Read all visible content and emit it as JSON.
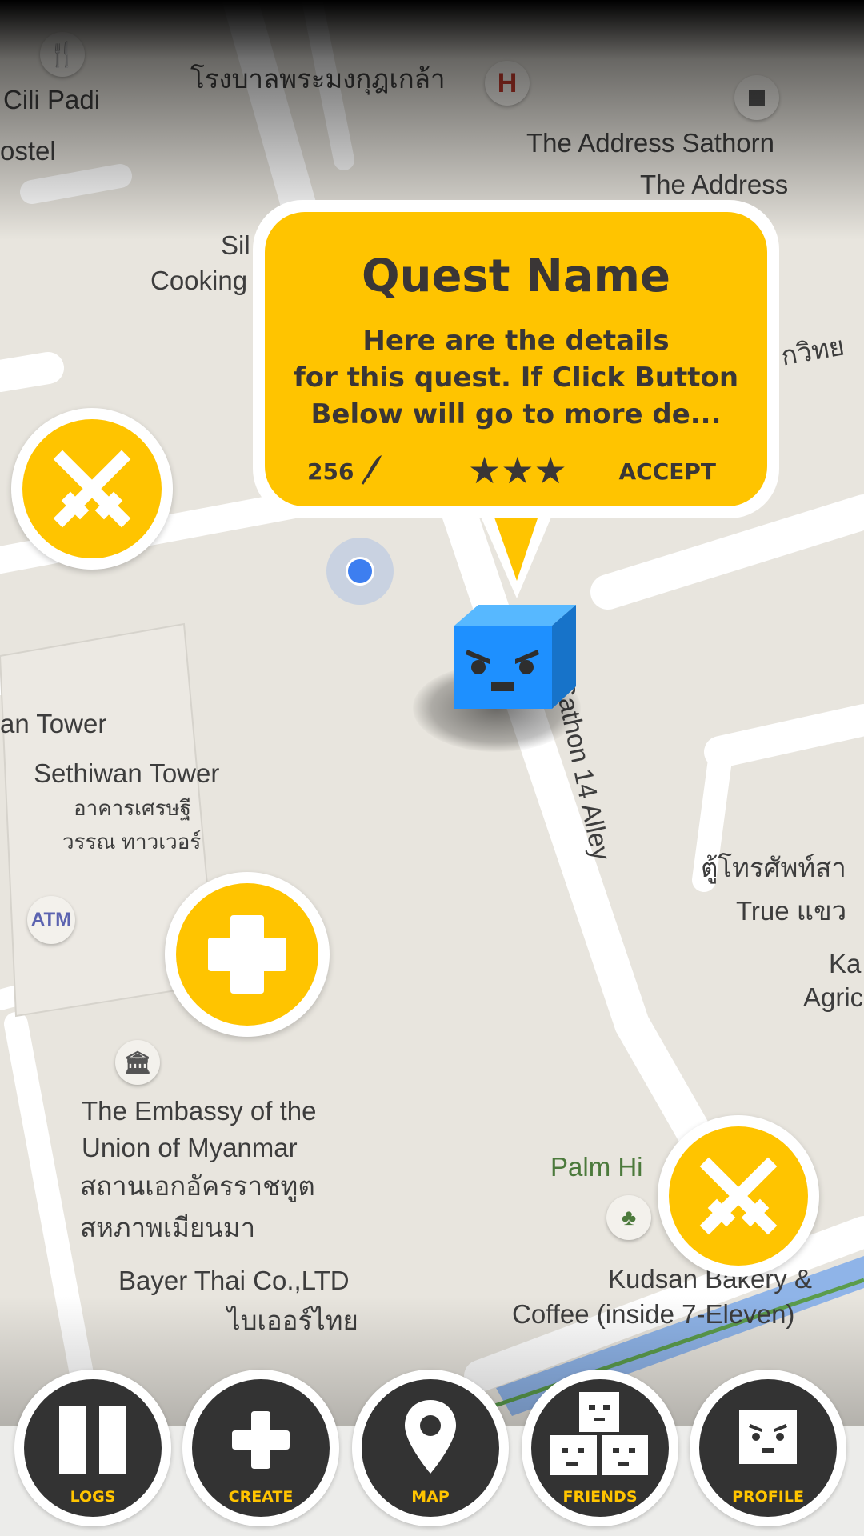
{
  "map": {
    "labels": {
      "cili_padi": "Cili Padi",
      "hostel": "ostel",
      "hospital_thai": "โรงบาลพระมงกุฎเกล้า",
      "address_sathorn": "The Address Sathorn",
      "the_address": "The Address",
      "sil": "Sil",
      "cooking": "Cooking",
      "thai_right": "กวิทย",
      "tower_cut": "an Tower",
      "sethiwan": "Sethiwan Tower",
      "sethiwan_thai1": "อาคารเศรษฐี",
      "sethiwan_thai2": "วรรณ ทาวเวอร์",
      "atm": "ATM",
      "sathon_alley": "Sathon 14 Alley",
      "phone_thai": "ตู้โทรศัพท์สา",
      "true_thai": "True แขว",
      "ka": "Ka",
      "agric": "Agric",
      "embassy1": "The Embassy of the",
      "embassy2": "Union of Myanmar",
      "embassy_thai1": "สถานเอกอัครราชทูต",
      "embassy_thai2": "สหภาพเมียนมา",
      "palm_hi": "Palm Hi",
      "bayer1": "Bayer Thai Co.,LTD",
      "bayer_thai": "ไบเออร์ไทย",
      "kudsan1": "Kudsan Bakery &",
      "kudsan2": "Coffee (inside 7-Eleven)"
    },
    "hospital_letter": "H"
  },
  "quest": {
    "title": "Quest Name",
    "description": "Here are the details\nfor this quest. If Click Button\nBelow will go to more de...",
    "points": "256",
    "rating": 3,
    "accept_label": "ACCEPT"
  },
  "nav": {
    "logs": "LOGS",
    "create": "CREATE",
    "map": "MAP",
    "friends": "FRIENDS",
    "profile": "PROFILE"
  },
  "colors": {
    "accent": "#ffc400",
    "dark": "#333333",
    "avatar": "#1e90ff",
    "user_location": "#3d7ef0"
  }
}
